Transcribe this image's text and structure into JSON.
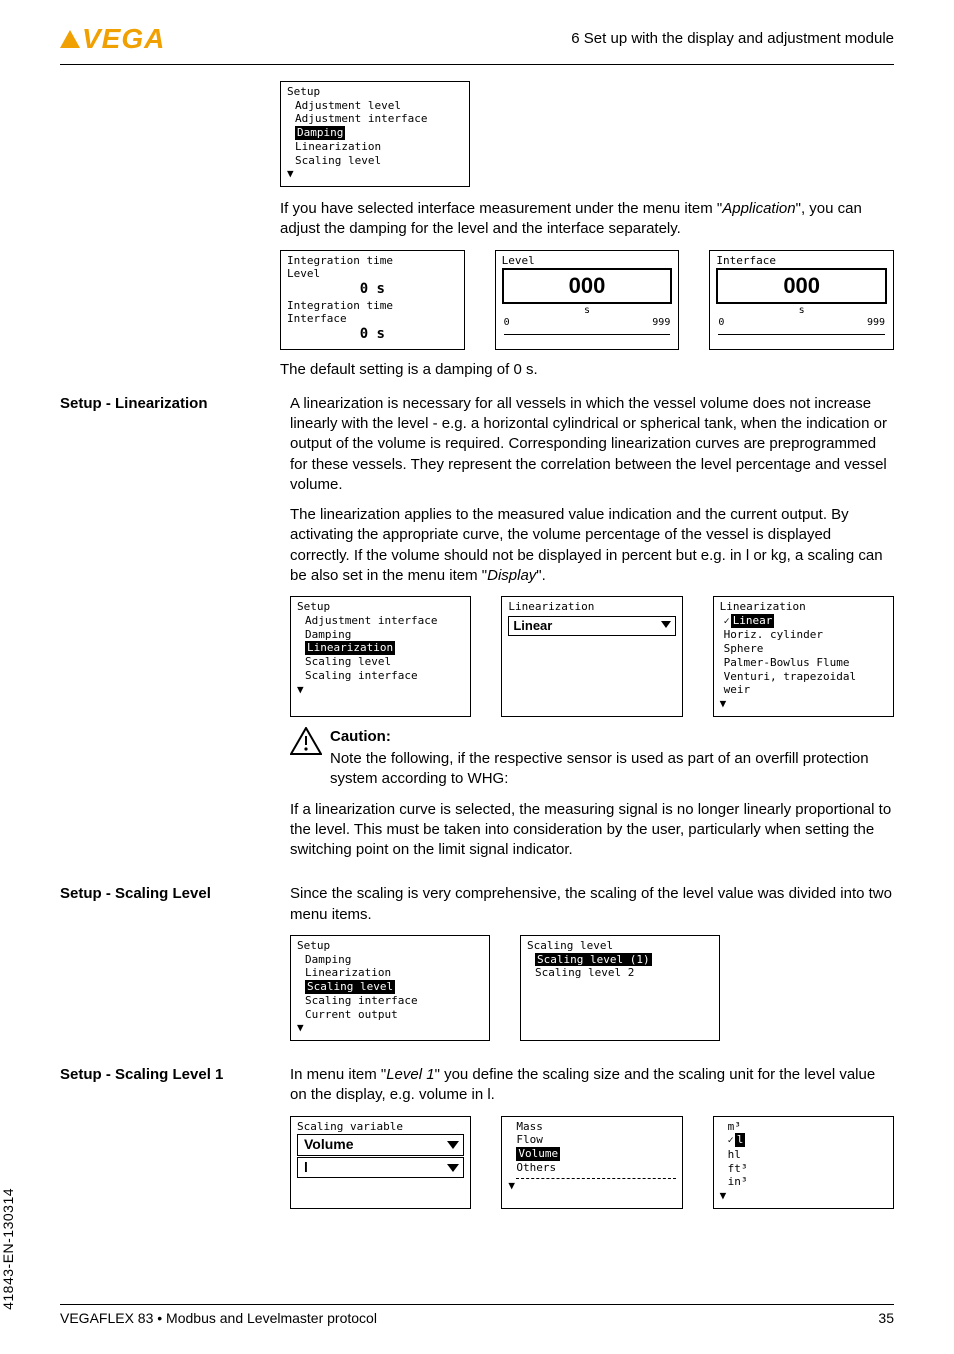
{
  "header": {
    "doc_section": "6 Set up with the display and adjustment module"
  },
  "logo_text": "VEGA",
  "lcd_setup1": {
    "title": "Setup",
    "l1": "Adjustment level",
    "l2": "Adjustment interface",
    "hl": "Damping",
    "l4": "Linearization",
    "l5": "Scaling level"
  },
  "para1a": "If you have selected interface measurement under the menu item \"",
  "para1_italic": "Application",
  "para1b": "\", you can adjust the damping for the level and the interface separately.",
  "lcd_int": {
    "t1": "Integration time",
    "l1": "Level",
    "v1": "0 s",
    "t2": "Integration time",
    "l2": "Interface",
    "v2": "0 s"
  },
  "lcd_level": {
    "title": "Level",
    "big": "000",
    "s": "s",
    "min": "0",
    "max": "999"
  },
  "lcd_iface": {
    "title": "Interface",
    "big": "000",
    "s": "s",
    "min": "0",
    "max": "999"
  },
  "para2": "The default setting is a damping of 0 s.",
  "sec_lin": "Setup - Linearization",
  "para3": "A linearization is necessary for all vessels in which the vessel volume does not increase linearly with the level - e.g. a horizontal cylindrical or spherical tank, when the indication or output of the volume is required. Corresponding linearization curves are preprogrammed for these vessels. They represent the correlation between the level percentage and vessel volume.",
  "para4a": "The linearization applies to the measured value indication and the current output. By activating the appropriate curve, the volume percentage of the vessel is displayed correctly. If the volume should not be displayed in percent but e.g. in l or kg, a scaling can be also set in the menu item \"",
  "para4_italic": "Display",
  "para4b": "\".",
  "lcd_setup2": {
    "title": "Setup",
    "l1": "Adjustment interface",
    "l2": "Damping",
    "hl": "Linearization",
    "l4": "Scaling level",
    "l5": "Scaling interface"
  },
  "lcd_lin": {
    "title": "Linearization",
    "value": "Linear"
  },
  "lcd_lin_list": {
    "title": "Linearization",
    "hl": "Linear",
    "l2": "Horiz. cylinder",
    "l3": "Sphere",
    "l4": "Palmer-Bowlus Flume",
    "l5": "Venturi, trapezoidal weir"
  },
  "caution": {
    "heading": "Caution:",
    "p1": "Note the following, if the respective sensor is used as part of an overfill protection system according to WHG:",
    "p2": "If a linearization curve is selected, the measuring signal is no longer linearly proportional to the level. This must be taken into consideration by the user, particularly when setting the switching point on the limit signal indicator."
  },
  "sec_scale": "Setup - Scaling Level",
  "para5": "Since the scaling is very comprehensive, the scaling of the level value was divided into two menu items.",
  "lcd_setup3": {
    "title": "Setup",
    "l1": "Damping",
    "l2": "Linearization",
    "hl": "Scaling level",
    "l4": "Scaling interface",
    "l5": "Current output"
  },
  "lcd_scale_list": {
    "title": "Scaling level",
    "hl": "Scaling level (1)",
    "l2": "Scaling level 2"
  },
  "sec_scale1": "Setup - Scaling Level 1",
  "para6a": "In menu item \"",
  "para6_italic": "Level 1",
  "para6b": "\" you define the scaling size and the scaling unit for the level value on the display, e.g. volume in l.",
  "lcd_var": {
    "title": "Scaling variable",
    "dd1": "Volume",
    "dd2": "l"
  },
  "lcd_mass": {
    "l1": "Mass",
    "l2": "Flow",
    "hl": "Volume",
    "l4": "Others"
  },
  "lcd_units": {
    "u1": "m³",
    "u2": "l",
    "u3": "hl",
    "u4": "ft³",
    "u5": "in³"
  },
  "sidecode": "41843-EN-130314",
  "footer": {
    "text": "VEGAFLEX 83 • Modbus and Levelmaster protocol",
    "page": "35"
  }
}
